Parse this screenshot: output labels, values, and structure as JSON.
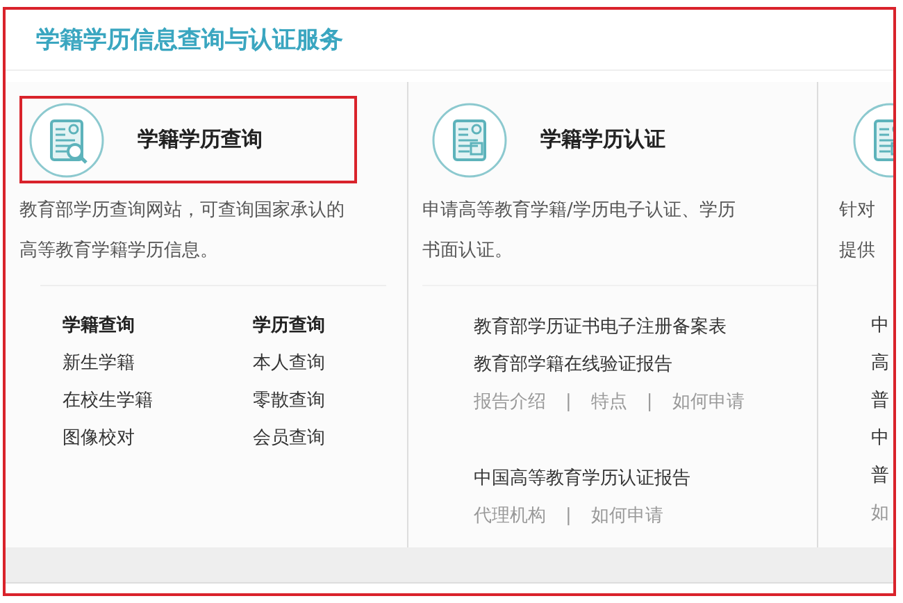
{
  "title": "学籍学历信息查询与认证服务",
  "cards": [
    {
      "kind": "query",
      "title": "学籍学历查询",
      "highlighted": true,
      "description_lines": [
        "教育部学历查询网站，可查询国家承认的",
        "高等教育学籍学历信息。"
      ],
      "groups": [
        {
          "heading": "学籍查询",
          "links": [
            "新生学籍",
            "在校生学籍",
            "图像校对"
          ]
        },
        {
          "heading": "学历查询",
          "links": [
            "本人查询",
            "零散查询",
            "会员查询"
          ]
        }
      ]
    },
    {
      "kind": "certify",
      "title": "学籍学历认证",
      "highlighted": false,
      "description_lines": [
        "申请高等教育学籍/学历电子认证、学历",
        "书面认证。"
      ],
      "sections": [
        {
          "items": [
            "教育部学历证书电子注册备案表",
            "教育部学籍在线验证报告"
          ],
          "links": [
            "报告介绍",
            "特点",
            "如何申请"
          ],
          "separator": "|"
        },
        {
          "items": [
            "中国高等教育学历认证报告"
          ],
          "links": [
            "代理机构",
            "如何申请"
          ],
          "separator": "|"
        }
      ]
    },
    {
      "kind": "partial",
      "description_lines": [
        "针对",
        "提供"
      ],
      "items": [
        "中",
        "高",
        "普",
        "中",
        "普"
      ],
      "links": [
        "如"
      ]
    }
  ]
}
